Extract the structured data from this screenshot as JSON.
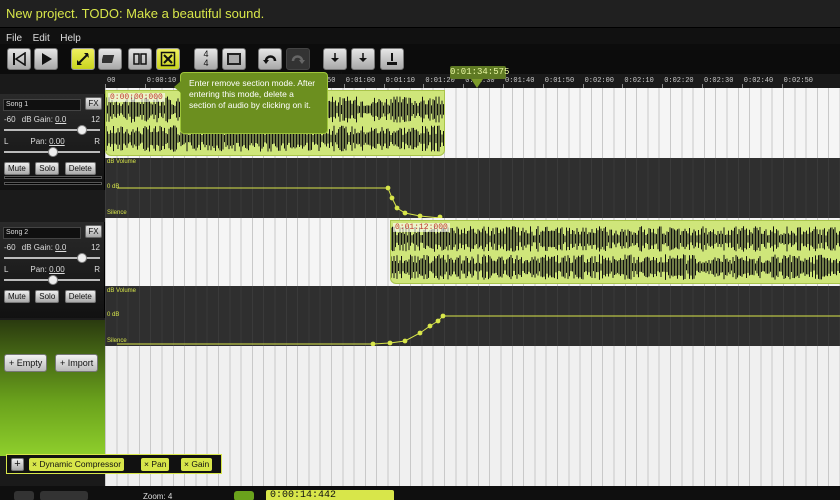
{
  "window": {
    "title": "New project. TODO: Make a beautiful sound."
  },
  "menu": {
    "items": [
      "File",
      "Edit",
      "Help"
    ]
  },
  "toolbar": {
    "time_signature_top": "4",
    "time_signature_bottom": "4",
    "export_wav": ".WAV",
    "export_mp3": ".MP3"
  },
  "tooltip": {
    "text": "Enter remove section mode. After entering this mode, delete a section of audio by clicking on it."
  },
  "ruler": {
    "ticks": [
      "00",
      "0:00:10",
      "0:00:20",
      "0:00:30",
      "0:00:40",
      "0:00:50",
      "0:01:00",
      "0:01:10",
      "0:01:20",
      "0:01:30",
      "0:01:40",
      "0:01:50",
      "0:02:00",
      "0:02:10",
      "0:02:20",
      "0:02:30",
      "0:02:40",
      "0:02:50"
    ],
    "playhead_time": "0:01:34:575"
  },
  "tracks": [
    {
      "name": "Song 1",
      "fx_label": "FX",
      "gain_min": "-60",
      "gain_label": "dB Gain:",
      "gain_value": "0.0",
      "gain_max": "12",
      "pan_left": "L",
      "pan_label": "Pan:",
      "pan_value": "0.00",
      "pan_right": "R",
      "mute_label": "Mute",
      "solo_label": "Solo",
      "delete_label": "Delete",
      "clip_start": "0:00:00:000",
      "volume_label": "dB Volume",
      "zero_db_label": "0 dB",
      "silence_label": "Silence"
    },
    {
      "name": "Song 2",
      "fx_label": "FX",
      "gain_min": "-60",
      "gain_label": "dB Gain:",
      "gain_value": "0.0",
      "gain_max": "12",
      "pan_left": "L",
      "pan_label": "Pan:",
      "pan_value": "0.00",
      "pan_right": "R",
      "mute_label": "Mute",
      "solo_label": "Solo",
      "delete_label": "Delete",
      "clip_start": "0:01:12:000",
      "volume_label": "dB Volume",
      "zero_db_label": "0 dB",
      "silence_label": "Silence"
    }
  ],
  "panel": {
    "empty_label": "+ Empty",
    "import_label": "+ Import"
  },
  "effects": {
    "add_label": "+",
    "items": [
      "× Dynamic Compressor",
      "× Pan",
      "× Gain"
    ]
  },
  "bottom": {
    "zoom_label": "Zoom: 4",
    "clock": "0:00:14:442"
  },
  "colors": {
    "accent": "#d8e64a",
    "clip": "#cfe67a",
    "green": "#6aa21c"
  }
}
